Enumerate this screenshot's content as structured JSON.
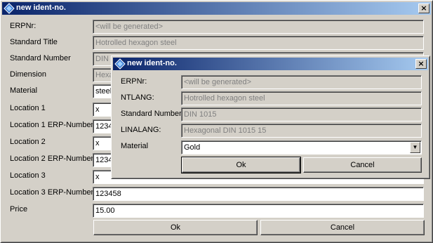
{
  "outer": {
    "title": "new ident-no.",
    "close_glyph": "×",
    "fields": [
      {
        "label": "ERPNr:",
        "value": "<will be generated>"
      },
      {
        "label": "Standard Title",
        "value": "Hotrolled hexagon steel"
      },
      {
        "label": "Standard Number",
        "value": "DIN"
      },
      {
        "label": "Dimension",
        "value": "Hexa"
      },
      {
        "label": "Material",
        "value": "steel"
      },
      {
        "label": "Location 1",
        "value": "x"
      },
      {
        "label": "Location 1 ERP-Number",
        "value": "1234"
      },
      {
        "label": "Location 2",
        "value": "x"
      },
      {
        "label": "Location 2 ERP-Number",
        "value": "1234"
      },
      {
        "label": "Location 3",
        "value": "x"
      },
      {
        "label": "Location 3 ERP-Number",
        "value": "123458"
      },
      {
        "label": "Price",
        "value": "15.00"
      }
    ],
    "ok_label": "Ok",
    "cancel_label": "Cancel"
  },
  "inner": {
    "title": "new ident-no.",
    "close_glyph": "×",
    "fields": [
      {
        "label": "ERPNr:",
        "value": "<will be generated>"
      },
      {
        "label": "NTLANG:",
        "value": "Hotrolled hexagon steel"
      },
      {
        "label": "Standard Number",
        "value": "DIN 1015"
      },
      {
        "label": "LINALANG:",
        "value": "Hexagonal DIN 1015 15"
      },
      {
        "label": "Material",
        "value": "Gold"
      }
    ],
    "ok_label": "Ok",
    "cancel_label": "Cancel",
    "dropdown_glyph": "▼"
  },
  "icons": {
    "app": "app-icon",
    "close": "close-icon",
    "dropdown": "chevron-down-icon"
  },
  "colors": {
    "title_start": "#0a246a",
    "title_end": "#a6caf0",
    "face": "#d4d0c8"
  }
}
